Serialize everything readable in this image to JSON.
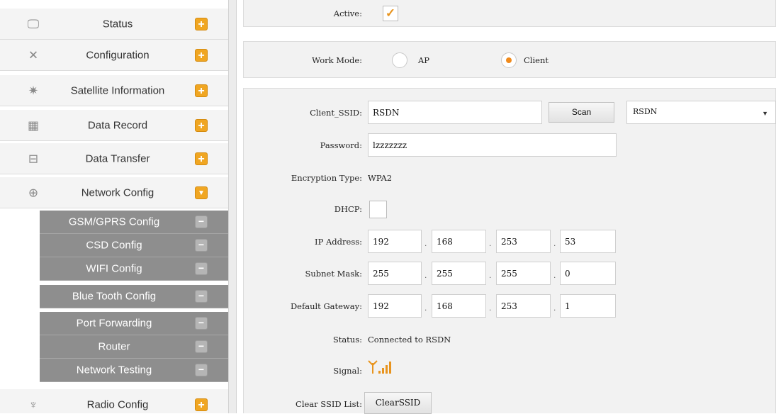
{
  "sidebar": {
    "items": [
      {
        "label": "Status",
        "icon": "monitor-icon",
        "glyph": "🖵",
        "state": "collapsed"
      },
      {
        "label": "Configuration",
        "icon": "tools-icon",
        "glyph": "✕",
        "state": "collapsed"
      },
      {
        "label": "Satellite Information",
        "icon": "satellite-icon",
        "glyph": "✷",
        "state": "collapsed"
      },
      {
        "label": "Data Record",
        "icon": "calendar-icon",
        "glyph": "▦",
        "state": "collapsed"
      },
      {
        "label": "Data Transfer",
        "icon": "network-transfer-icon",
        "glyph": "⊟",
        "state": "collapsed"
      },
      {
        "label": "Network Config",
        "icon": "globe-icon",
        "glyph": "⊕",
        "state": "expanded"
      },
      {
        "label": "Radio Config",
        "icon": "radio-antenna-icon",
        "glyph": "♆",
        "state": "collapsed"
      }
    ],
    "network_subitems": [
      "GSM/GPRS Config",
      "CSD Config",
      "WIFI Config",
      "Blue Tooth Config",
      "Port Forwarding",
      "Router",
      "Network Testing"
    ]
  },
  "wifi": {
    "active_label": "Active:",
    "active_checked": true,
    "work_mode_label": "Work Mode:",
    "mode_ap_label": "AP",
    "mode_client_label": "Client",
    "selected_mode": "Client",
    "client_ssid_label": "Client_SSID:",
    "client_ssid_value": "RSDN",
    "scan_label": "Scan",
    "ssid_dropdown_value": "RSDN",
    "password_label": "Password:",
    "password_value": "lzzzzzzz",
    "encryption_label": "Encryption Type:",
    "encryption_value": "WPA2",
    "dhcp_label": "DHCP:",
    "dhcp_checked": false,
    "ip_label": "IP Address:",
    "ip": [
      "192",
      "168",
      "253",
      "53"
    ],
    "subnet_label": "Subnet Mask:",
    "subnet": [
      "255",
      "255",
      "255",
      "0"
    ],
    "gateway_label": "Default Gateway:",
    "gateway": [
      "192",
      "168",
      "253",
      "1"
    ],
    "status_label": "Status:",
    "status_value": "Connected to RSDN",
    "signal_label": "Signal:",
    "signal_bars": 4,
    "clear_label": "Clear SSID List:",
    "clear_button": "ClearSSID"
  },
  "colors": {
    "accent": "#f0a622",
    "submenu_bg": "#8e8e8e",
    "radio_selected": "#f08a1c"
  }
}
